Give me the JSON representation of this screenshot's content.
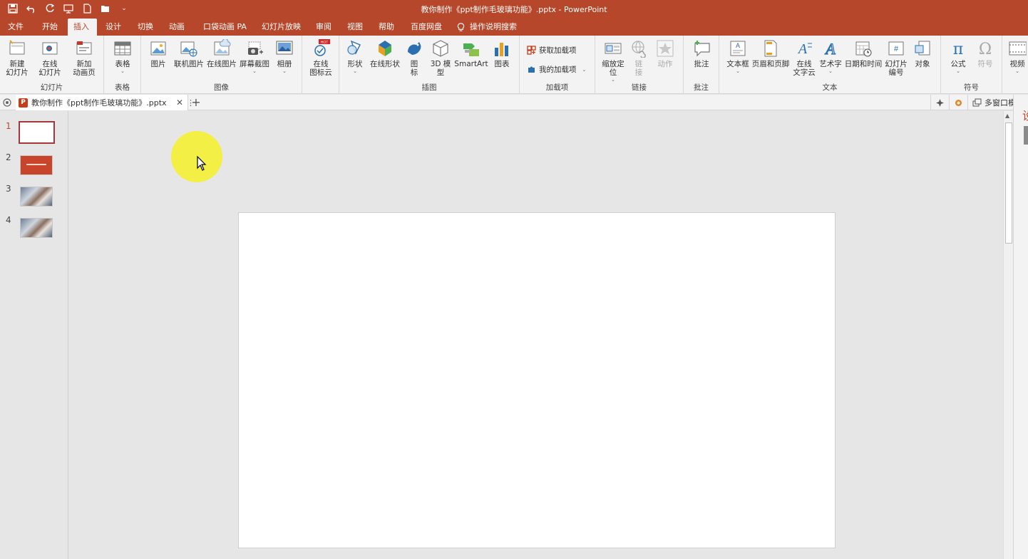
{
  "app": {
    "title": "教你制作《ppt制作毛玻璃功能》.pptx  -  PowerPoint"
  },
  "menu_tabs": [
    {
      "label": "文件"
    },
    {
      "label": "开始"
    },
    {
      "label": "插入",
      "active": true
    },
    {
      "label": "设计"
    },
    {
      "label": "切换"
    },
    {
      "label": "动画"
    },
    {
      "label": "口袋动画 PA"
    },
    {
      "label": "幻灯片放映"
    },
    {
      "label": "审阅"
    },
    {
      "label": "视图"
    },
    {
      "label": "帮助"
    },
    {
      "label": "百度网盘"
    }
  ],
  "tell_me": "操作说明搜索",
  "ribbon": {
    "slides": {
      "label": "幻灯片",
      "new_slide": "新建\n幻灯片",
      "online_slide": "在线\n幻灯片",
      "new_anim_page": "新加\n动画页"
    },
    "table": {
      "label": "表格",
      "table_btn": "表格"
    },
    "images": {
      "label": "图像",
      "picture": "图片",
      "online_picture": "联机图片",
      "web_picture": "在线图片",
      "screenshot": "屏幕截图",
      "album": "相册"
    },
    "icon_cloud": {
      "label": "在线\n图标云",
      "hot": "HOT"
    },
    "illustrations": {
      "label": "插图",
      "shapes": "形状",
      "online_shapes": "在线形状",
      "icons": "图\n标",
      "model3d": "3D 模\n型",
      "smartart": "SmartArt",
      "chart": "图表"
    },
    "addins": {
      "label": "加载项",
      "get": "获取加载项",
      "mine": "我的加载项"
    },
    "links": {
      "label": "链接",
      "zoom": "缩放定\n位",
      "link": "链\n接",
      "action": "动作"
    },
    "comments": {
      "label": "批注",
      "comment": "批注"
    },
    "text": {
      "label": "文本",
      "textbox": "文本框",
      "header_footer": "页眉和页脚",
      "online_text": "在线\n文字云",
      "wordart": "艺术字",
      "datetime": "日期和时间",
      "slide_number": "幻灯片\n编号",
      "object": "对象"
    },
    "symbols": {
      "label": "符号",
      "equation": "公式",
      "symbol": "符号"
    },
    "media": {
      "video": "视频"
    }
  },
  "doc_tab": {
    "name": "教你制作《ppt制作毛玻璃功能》.pptx",
    "close": "✕",
    "more": "⋮",
    "new": "+"
  },
  "strip_right": {
    "multiwindow": "多窗口模式"
  },
  "slides": [
    {
      "number": "1",
      "kind": "blank",
      "active": true
    },
    {
      "number": "2",
      "kind": "red"
    },
    {
      "number": "3",
      "kind": "photo"
    },
    {
      "number": "4",
      "kind": "photo"
    }
  ],
  "right_pane": {
    "char": "设"
  },
  "colors": {
    "accent": "#b7472a",
    "ribbon_bg": "#f3f3f3",
    "workspace_bg": "#e6e6e6",
    "highlight": "#f5f028"
  }
}
